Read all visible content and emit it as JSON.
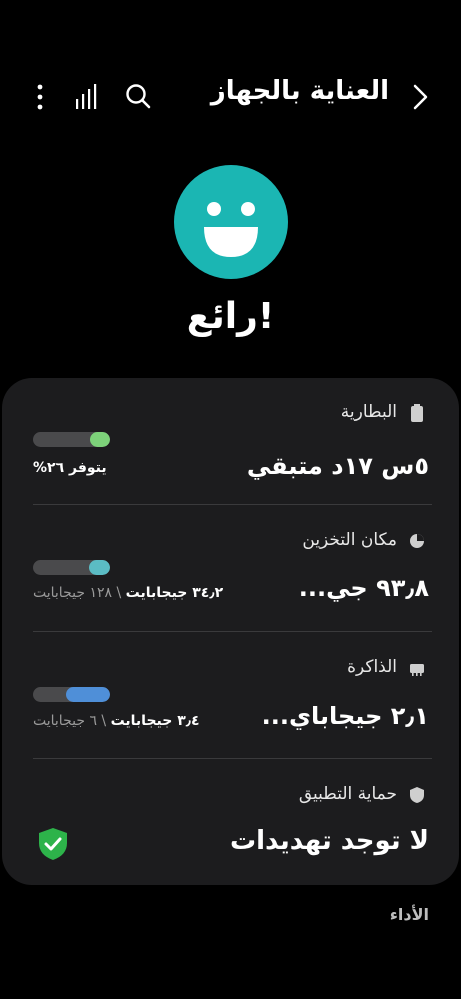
{
  "header": {
    "title": "العناية بالجهاز",
    "back_icon": "chevron-back-icon",
    "search_icon": "search-icon",
    "signal_icon": "signal-bars-icon",
    "more_icon": "more-vert-icon"
  },
  "status": {
    "face_color": "#1bb6b3",
    "label": "رائع!"
  },
  "battery": {
    "label": "البطارية",
    "value": "٥س ١٧د متبقي",
    "saving": "يتوفر ٢٦%",
    "bar_color": "#7dd27a",
    "bar_level": 0.26
  },
  "storage": {
    "label": "مكان التخزين",
    "value": "٩٣٫٨ جي...",
    "used": "٣٤٫٢ جيجابايت",
    "separator": " \\ ",
    "total": "١٢٨ جيجابايت",
    "bar_color": "#5bbcc4",
    "bar_level": 0.27
  },
  "memory": {
    "label": "الذاكرة",
    "value": "٢٫١ جيجاباي...",
    "used": "٣٫٤ جيجابايت",
    "separator": " \\ ",
    "total": "٦ جيجابايت",
    "bar_color": "#4f8fd8",
    "bar_level": 0.57
  },
  "app_protection": {
    "label": "حماية التطبيق",
    "value": "لا توجد تهديدات",
    "shield_color": "#2db34a"
  },
  "performance": {
    "label": "الأداء"
  }
}
